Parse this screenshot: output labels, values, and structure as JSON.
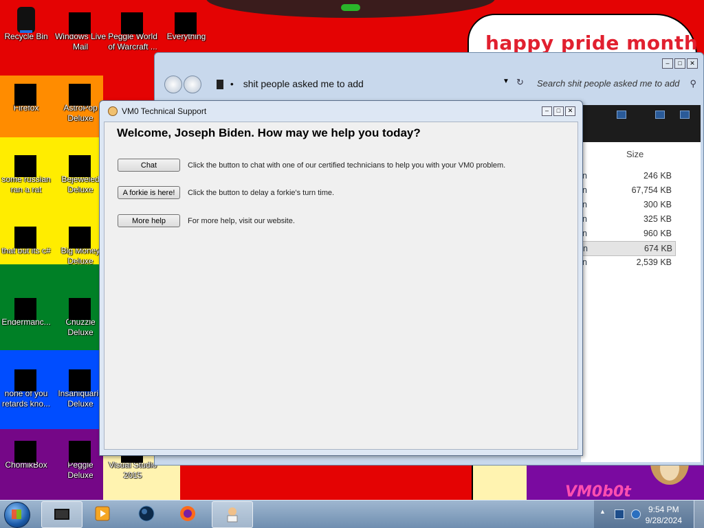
{
  "wallpaper": {
    "banner_text": "happy pride month",
    "logo_text": "VM0b0t"
  },
  "desktop_icons": [
    {
      "label": "Recycle Bin"
    },
    {
      "label": "Windows Live Mail"
    },
    {
      "label": "Peggle World of Warcraft ..."
    },
    {
      "label": "Everything"
    },
    {
      "label": "Firefox"
    },
    {
      "label": "AstroPop Deluxe"
    },
    {
      "label": "some russian ran a rat"
    },
    {
      "label": "Bejeweled Deluxe"
    },
    {
      "label": "that but its c#"
    },
    {
      "label": "Big Money Deluxe"
    },
    {
      "label": "Endermanc..."
    },
    {
      "label": "Chuzzle Deluxe"
    },
    {
      "label": "none of you retards kno..."
    },
    {
      "label": "Insaniquari.. Deluxe"
    },
    {
      "label": "ChomikBox"
    },
    {
      "label": "Peggle Deluxe"
    },
    {
      "label": "Visual Studio 2015"
    }
  ],
  "explorer": {
    "address": "shit people asked me to add",
    "search_placeholder": "Search shit people asked me to add",
    "size_header": "Size",
    "rows": [
      {
        "n": "n",
        "size": "246 KB"
      },
      {
        "n": "n",
        "size": "67,754 KB"
      },
      {
        "n": "n",
        "size": "300 KB"
      },
      {
        "n": "n",
        "size": "325 KB"
      },
      {
        "n": "n",
        "size": "960 KB"
      },
      {
        "n": "n",
        "size": "674 KB",
        "selected": true
      },
      {
        "n": "n",
        "size": "2,539 KB"
      }
    ]
  },
  "dialog": {
    "title": "VM0 Technical Support",
    "welcome": "Welcome, Joseph Biden. How may we help you today?",
    "actions": [
      {
        "button": "Chat",
        "description": "Click the button to chat with one of our certified technicians to help you with your VM0 problem."
      },
      {
        "button": "A forkie is here!",
        "description": "Click the button to delay a forkie's turn time."
      },
      {
        "button": "More help",
        "description": "For more help, visit our website."
      }
    ]
  },
  "taskbar": {
    "apps": [
      "vm-app",
      "media-player",
      "dark-globe",
      "firefox",
      "tech-support"
    ],
    "time": "9:54 PM",
    "date": "9/28/2024"
  },
  "colors": {
    "dialog_bg": "#f0f0f0",
    "title_bar": "#dde7f4",
    "taskbar": "#7f9ebf"
  }
}
